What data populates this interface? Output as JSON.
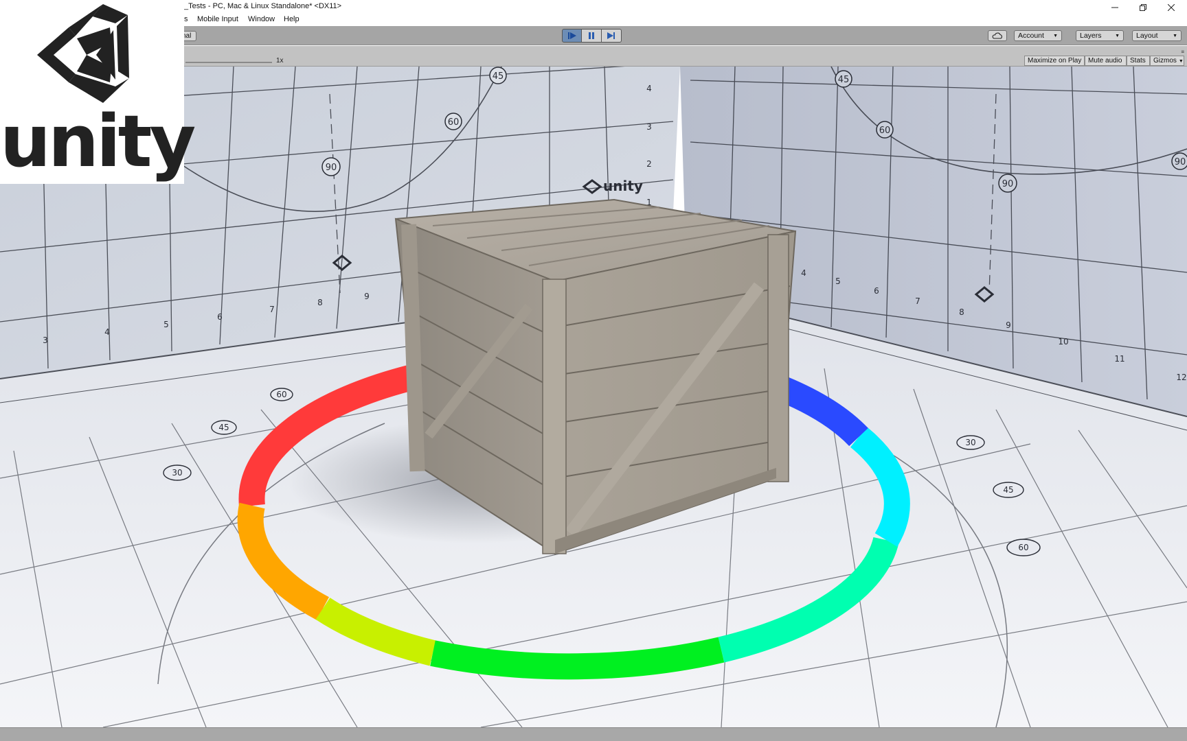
{
  "window": {
    "title": "_Tests - PC, Mac & Linux Standalone* <DX11>",
    "controls": [
      "minimize-icon",
      "restore-icon",
      "close-icon"
    ]
  },
  "menu": {
    "items": [
      "s",
      "Mobile Input",
      "Window",
      "Help"
    ]
  },
  "toolbar": {
    "fragment_label": "nal",
    "play_icon": "play-icon",
    "pause_icon": "pause-icon",
    "step_icon": "step-icon",
    "cloud_icon": "cloud-icon",
    "account_label": "Account",
    "layers_label": "Layers",
    "layout_label": "Layout",
    "play_active_color": "#6d8db5"
  },
  "game_header": {
    "scale_label": "1x",
    "maximize_label": "Maximize on Play",
    "mute_label": "Mute audio",
    "stats_label": "Stats",
    "gizmos_label": "Gizmos"
  },
  "scene": {
    "back_wall_logo_text": "unity",
    "left_wall_angle_labels": [
      "45",
      "60",
      "90"
    ],
    "left_wall_scale_numbers": [
      "3",
      "4",
      "5",
      "6",
      "7",
      "8",
      "9"
    ],
    "left_wall_ruler_numbers": [
      "1",
      "2",
      "3",
      "4"
    ],
    "right_wall_angle_labels": [
      "45",
      "60",
      "90",
      "90"
    ],
    "right_wall_scale_numbers": [
      "4",
      "5",
      "6",
      "7",
      "8",
      "9",
      "10",
      "11",
      "12"
    ],
    "floor_angle_labels_left": [
      "60",
      "45",
      "30"
    ],
    "floor_angle_labels_right": [
      "30",
      "45",
      "60"
    ],
    "ring_colors": [
      "#ff0000",
      "#ff7f00",
      "#ffff00",
      "#00ff00",
      "#00ffff",
      "#0000ff",
      "#ff00ff"
    ]
  },
  "logo": {
    "wordmark": "unity",
    "icon": "unity-cube-icon"
  }
}
